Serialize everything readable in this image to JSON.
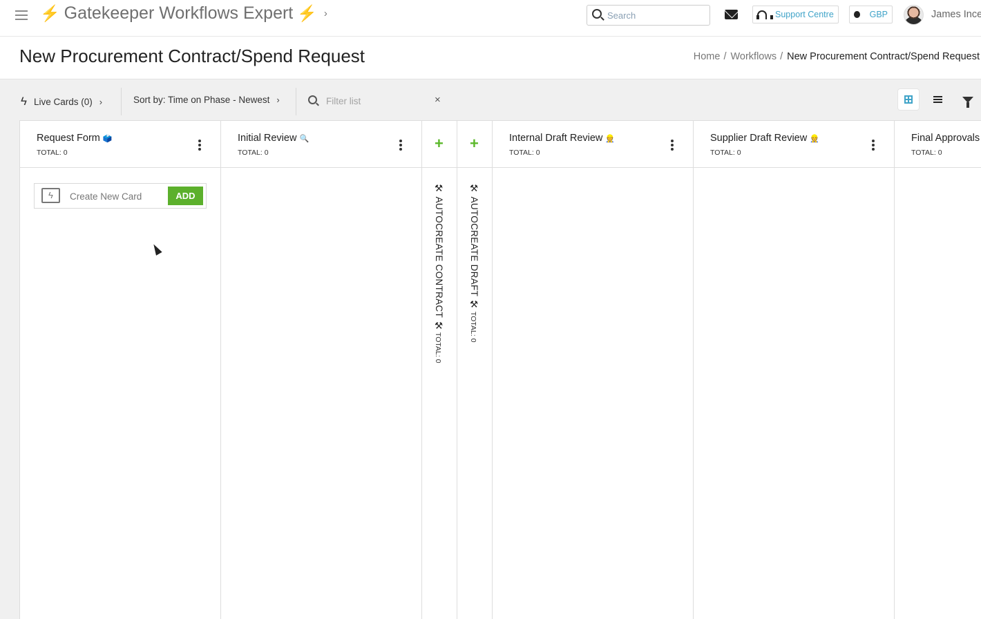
{
  "topbar": {
    "app_title": "Gatekeeper Workflows Expert",
    "bolt_glyph": "⚡",
    "search_placeholder": "Search",
    "support_label": "Support Centre",
    "currency_label": "GBP",
    "user_name": "James Ince",
    "accent_color": "#3fa3c8"
  },
  "page": {
    "title": "New Procurement Contract/Spend Request",
    "breadcrumb": [
      {
        "label": "Home"
      },
      {
        "label": "Workflows"
      },
      {
        "label": "New Procurement Contract/Spend Request"
      }
    ]
  },
  "toolbar": {
    "live_cards_label": "Live Cards (0)",
    "sort_label": "Sort by: Time on Phase - Newest",
    "filter_placeholder": "Filter list",
    "clear_glyph": "×"
  },
  "columns": [
    {
      "title": "Request Form",
      "emoji": "🗳️",
      "total": "TOTAL: 0"
    },
    {
      "title": "Initial Review",
      "emoji": "🔍",
      "total": "TOTAL: 0"
    },
    {
      "title": "Internal Draft Review",
      "emoji": "👷",
      "total": "TOTAL: 0"
    },
    {
      "title": "Supplier Draft Review",
      "emoji": "👷",
      "total": "TOTAL: 0"
    },
    {
      "title": "Final Approvals",
      "emoji": "",
      "total": "TOTAL: 0"
    }
  ],
  "automation_columns": [
    {
      "label": "⚒ AUTOCREATE CONTRACT ⚒",
      "total": "TOTAL: 0"
    },
    {
      "label": "⚒ AUTOCREATE DRAFT ⚒",
      "total": "TOTAL: 0"
    }
  ],
  "create_card": {
    "placeholder": "Create New Card",
    "add_label": "ADD",
    "add_color": "#5cb02c"
  },
  "icons": [
    "menu-icon",
    "bolt-icon",
    "chevron-right-icon",
    "search-icon",
    "mail-icon",
    "headset-icon",
    "coin-icon",
    "grid-view-icon",
    "list-view-icon",
    "filter-icon",
    "kebab-icon",
    "plus-icon"
  ]
}
